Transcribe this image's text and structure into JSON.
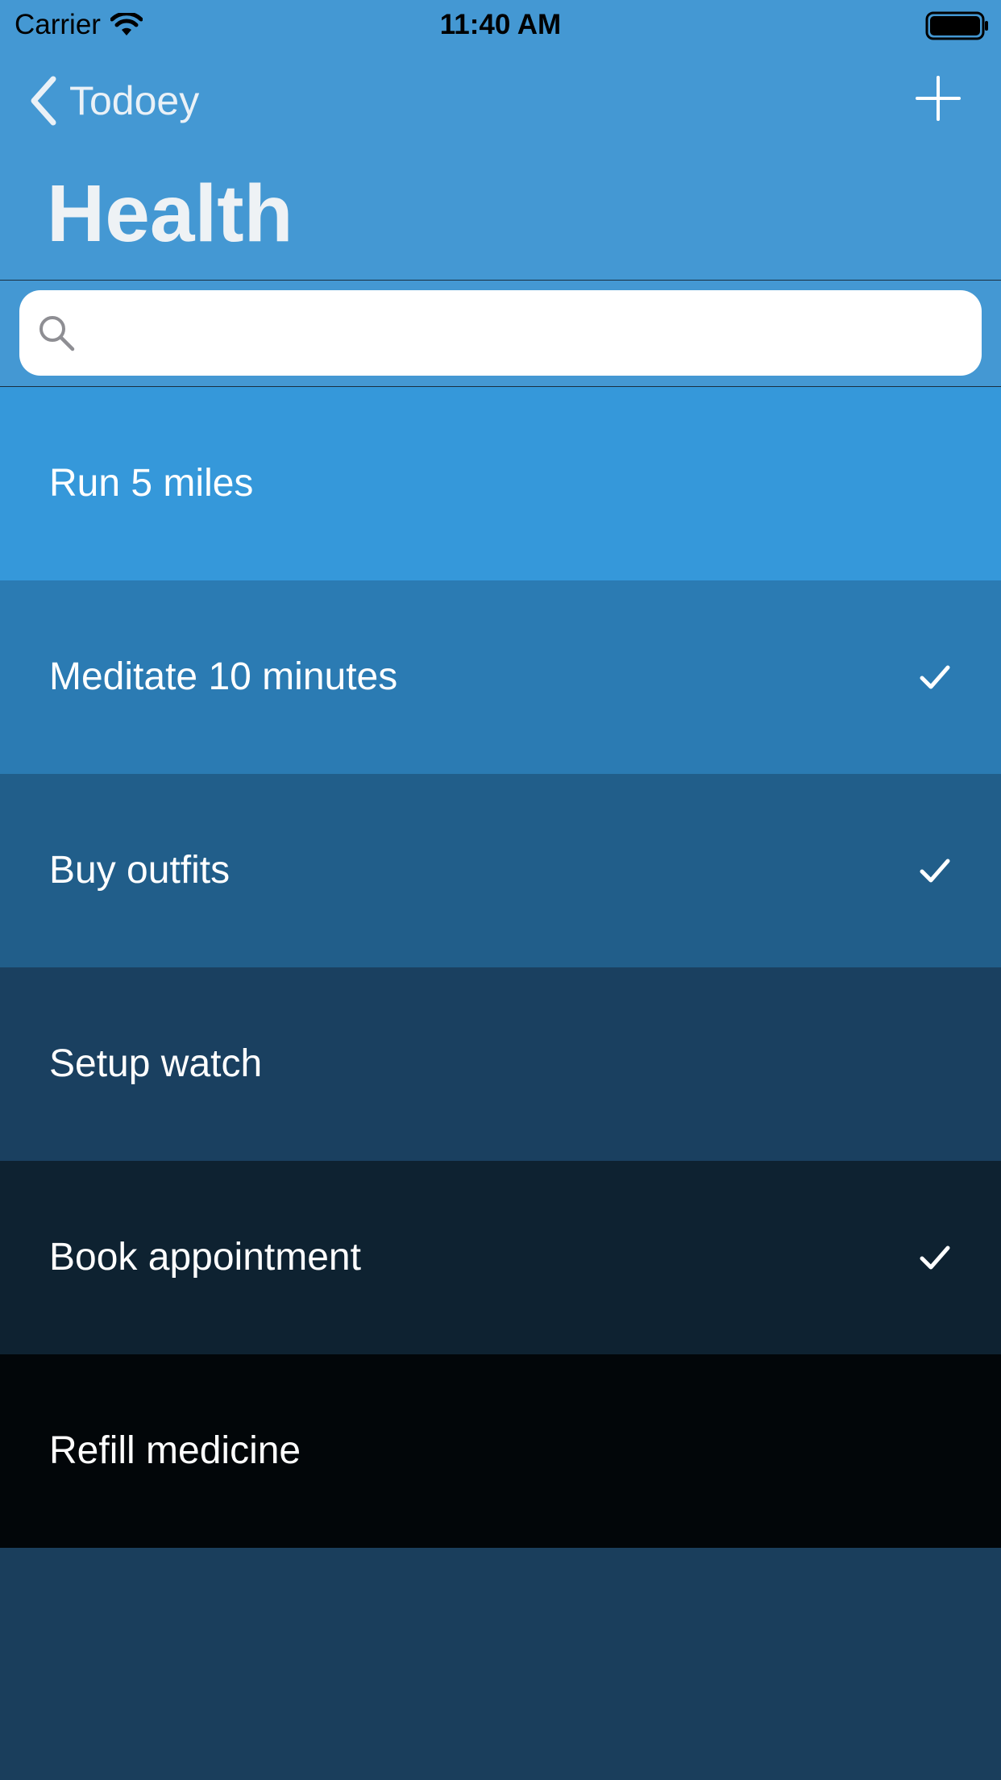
{
  "status_bar": {
    "carrier": "Carrier",
    "time": "11:40 AM"
  },
  "nav": {
    "back_label": "Todoey",
    "add_icon": "plus-icon",
    "back_icon": "chevron-left-icon"
  },
  "page_title": "Health",
  "search": {
    "placeholder": "",
    "value": ""
  },
  "items": [
    {
      "title": "Run 5 miles",
      "done": false,
      "color": "#3598da"
    },
    {
      "title": "Meditate 10 minutes",
      "done": true,
      "color": "#2b7bb3"
    },
    {
      "title": "Buy outfits",
      "done": true,
      "color": "#215e8a"
    },
    {
      "title": "Setup watch",
      "done": false,
      "color": "#1a4060"
    },
    {
      "title": "Book appointment",
      "done": true,
      "color": "#0e2231"
    },
    {
      "title": "Refill medicine",
      "done": false,
      "color": "#020609"
    }
  ],
  "colors": {
    "header": "#4498d3",
    "background": "#1a3e5c"
  }
}
